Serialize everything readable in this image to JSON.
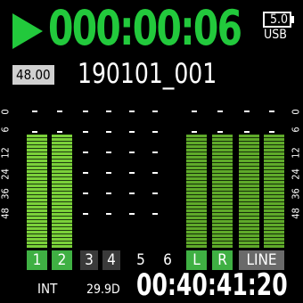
{
  "status": {
    "counter": "000:00:06",
    "battery_label": "5.0",
    "power_source": "USB"
  },
  "file": {
    "sample_rate": "48.00",
    "name": "190101_001"
  },
  "meter_scale": {
    "labels": [
      "0",
      "6",
      "12",
      "24",
      "36",
      "48"
    ]
  },
  "tracks": [
    {
      "label": "1"
    },
    {
      "label": "2"
    },
    {
      "label": "3"
    },
    {
      "label": "4"
    },
    {
      "label": "5"
    },
    {
      "label": "6"
    },
    {
      "label": "L"
    },
    {
      "label": "R"
    },
    {
      "label": "LINE"
    }
  ],
  "timecode": {
    "source": "INT",
    "fps": "29.9D",
    "value": "00:40:41:20"
  },
  "colors": {
    "accent_green": "#22c93c",
    "meter_green": "#7bd13a",
    "track_active": "#3fb043"
  }
}
